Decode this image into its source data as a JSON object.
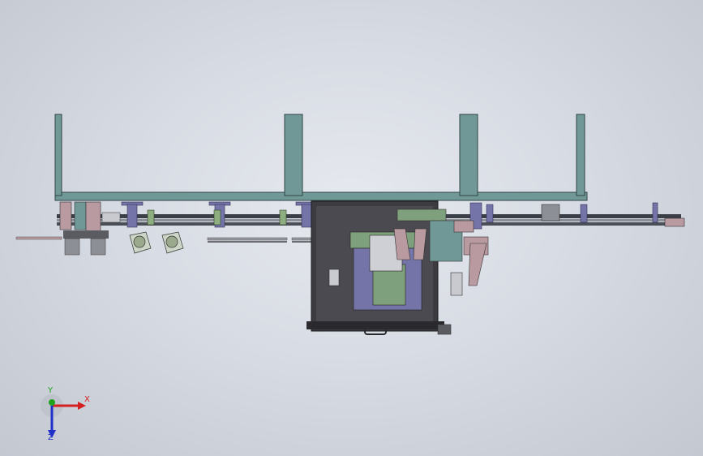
{
  "triad": {
    "x_label": "X",
    "y_label": "Y",
    "z_label": "Z",
    "x_color": "#d42020",
    "y_color": "#1fa31f",
    "z_color": "#2030c8"
  },
  "colors": {
    "frame": "#6f9896",
    "frame_edge": "#2f4444",
    "bracket": "#7474a8",
    "fixture_pink": "#b89aa0",
    "plate_green": "#7fa07c",
    "box_dark": "#3c3c40",
    "rail": "#4a4e56"
  }
}
